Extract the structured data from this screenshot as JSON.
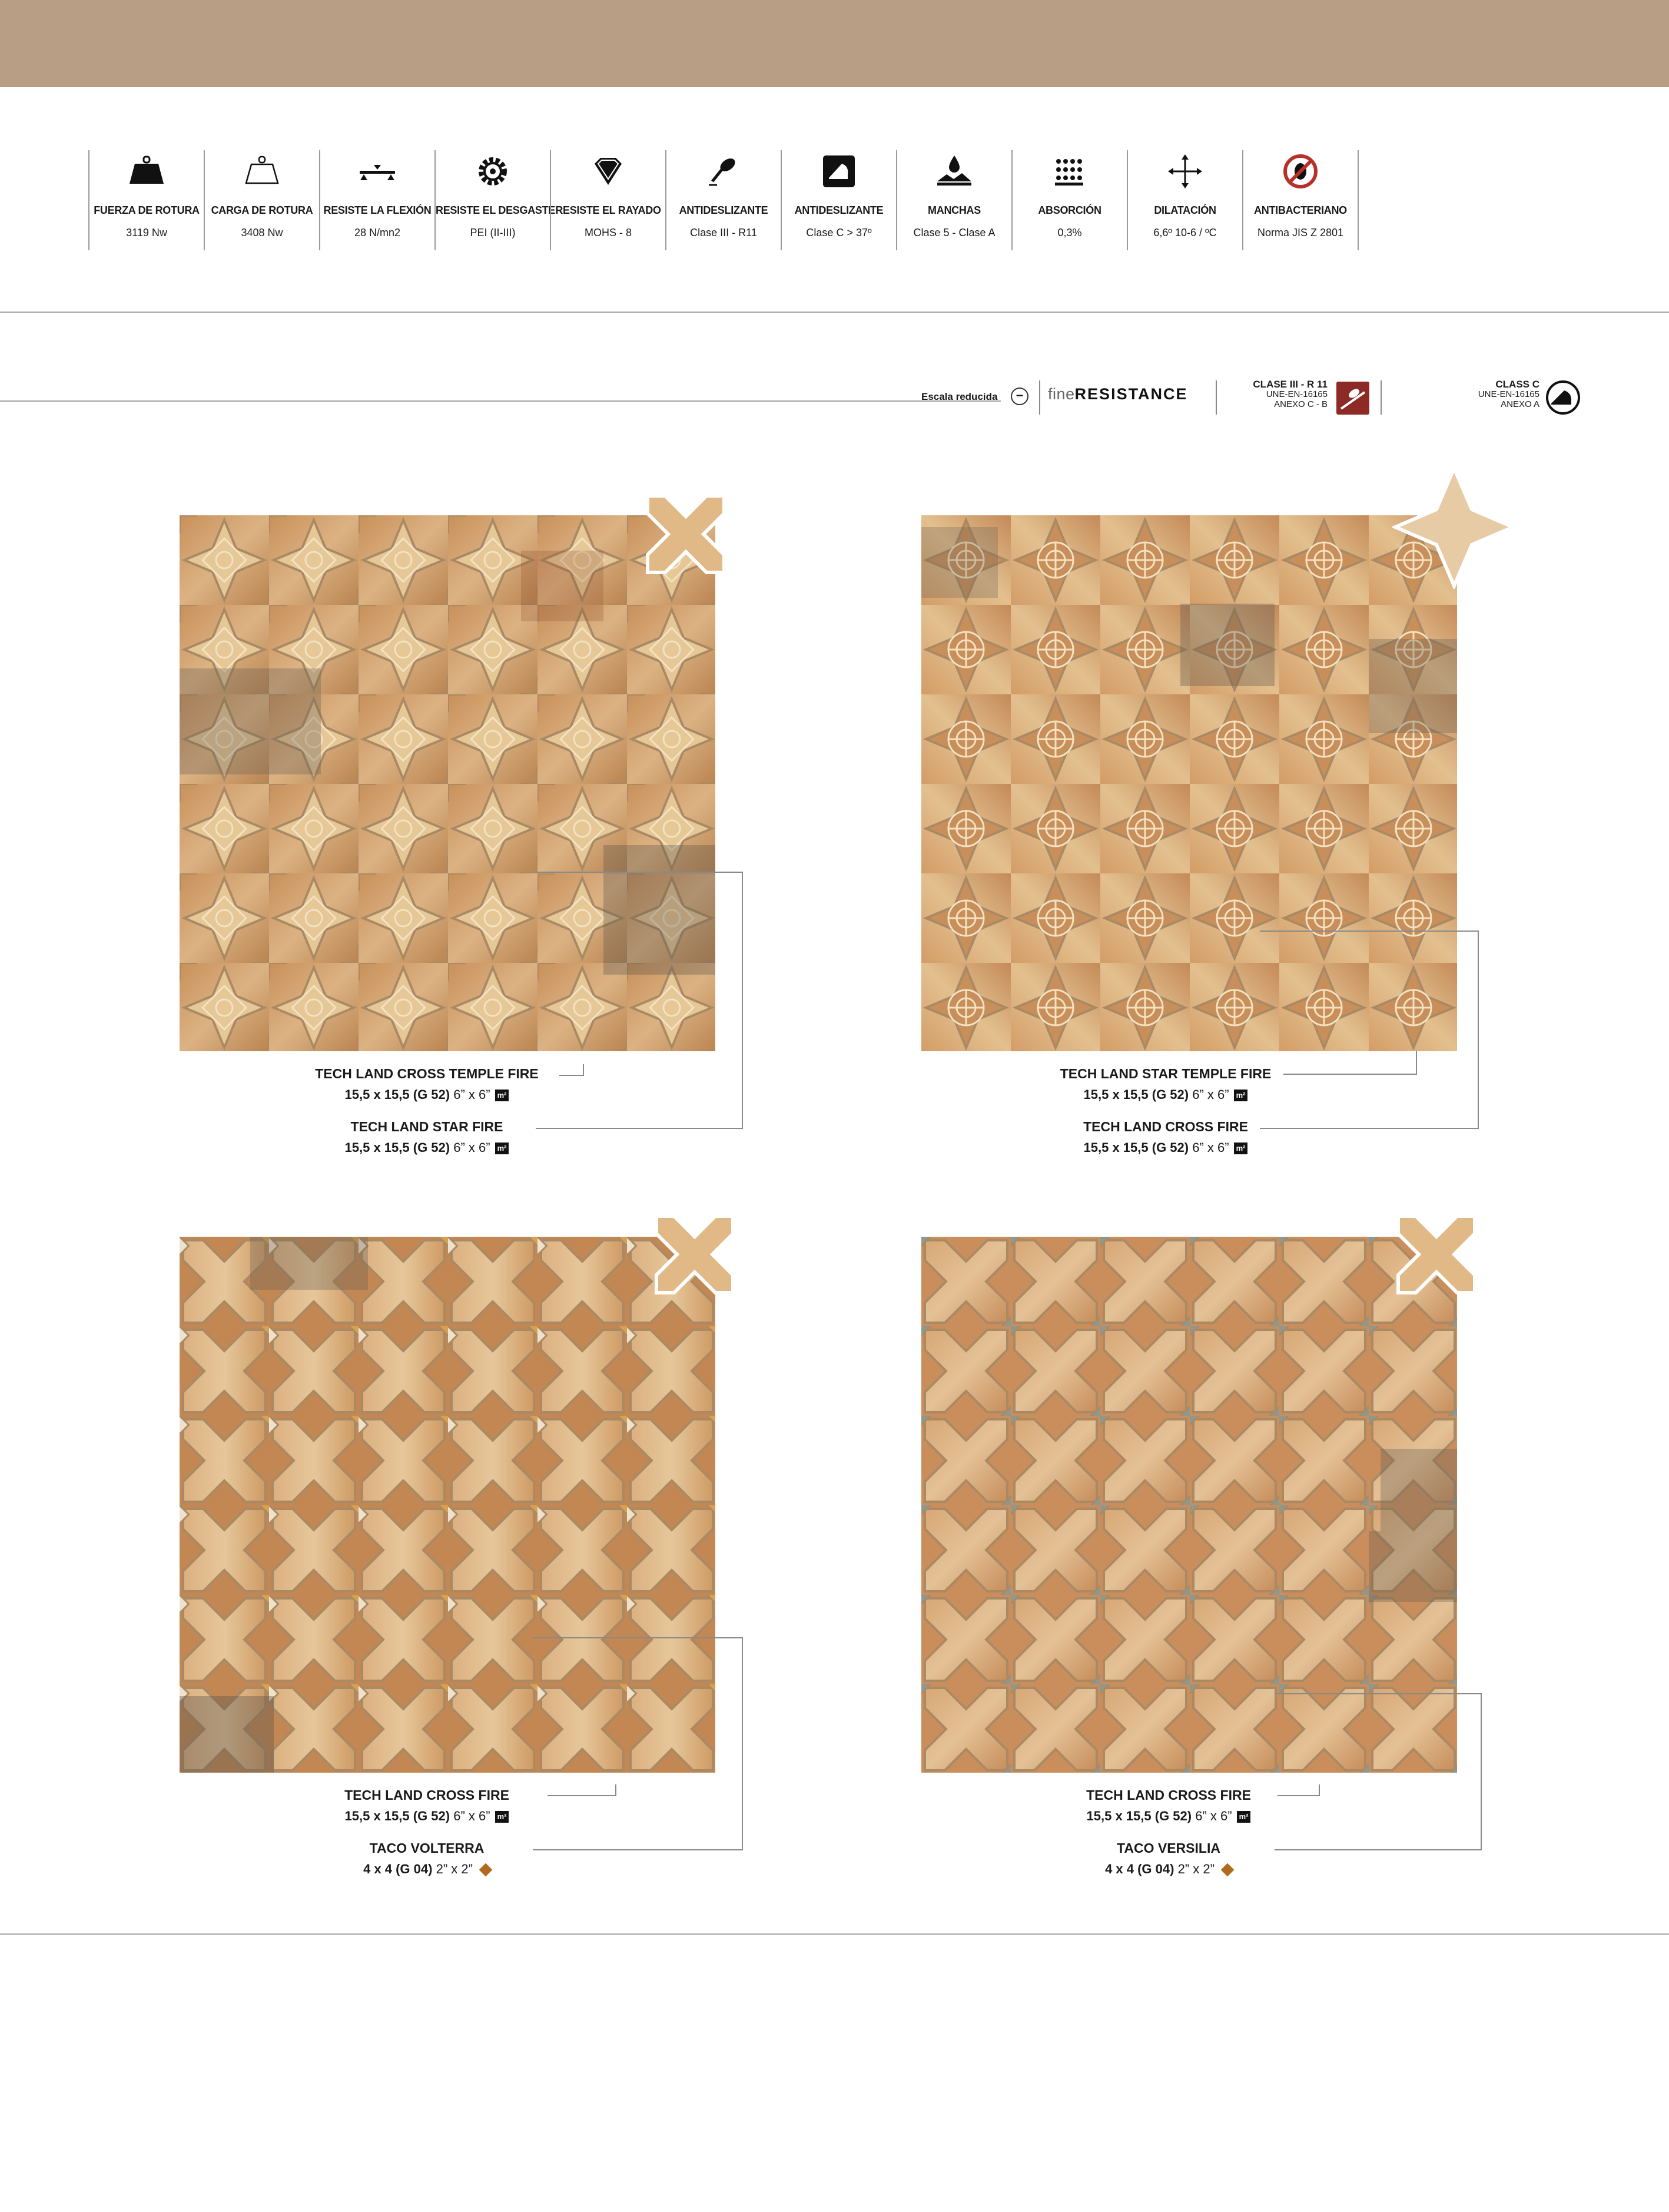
{
  "colors": {
    "topbar": "#b89e84",
    "terracotta": "#c98a52",
    "sand": "#e4c291",
    "smoke": "#7d7065",
    "joint": "#b9a98f"
  },
  "specs": [
    {
      "icon": "weight-icon",
      "title": "FUERZA DE ROTURA",
      "value": "3119 Nw"
    },
    {
      "icon": "load-weight-outline-icon",
      "title": "CARGA DE ROTURA",
      "value": "3408 Nw"
    },
    {
      "icon": "flexion-icon",
      "title": "RESISTE LA FLEXIÓN",
      "value": "28 N/mn2"
    },
    {
      "icon": "gear-wear-icon",
      "title": "RESISTE EL DESGASTE",
      "value": "PEI (II-III)"
    },
    {
      "icon": "diamond-icon",
      "title": "RESISTE EL RAYADO",
      "value": "MOHS - 8"
    },
    {
      "icon": "anti-slip-shoe-icon",
      "title": "ANTIDESLIZANTE",
      "value": "Clase III - R11"
    },
    {
      "icon": "slip-angle-icon",
      "title": "ANTIDESLIZANTE",
      "value": "Clase C > 37º"
    },
    {
      "icon": "stain-drop-icon",
      "title": "MANCHAS",
      "value": "Clase 5 - Clase A"
    },
    {
      "icon": "absorption-drops-icon",
      "title": "ABSORCIÓN",
      "value": "0,3%"
    },
    {
      "icon": "dilation-arrows-icon",
      "title": "DILATACIÓN",
      "value": "6,6º 10-6 / ºC"
    },
    {
      "icon": "antibacterial-icon",
      "title": "ANTIBACTERIANO",
      "value": "Norma JIS Z 2801"
    }
  ],
  "legend": {
    "escala": "Escala reducida",
    "fine_a": "fine",
    "fine_b": "RESISTANCE",
    "r11_title": "CLASE III - R 11",
    "r11_line1": "UNE-EN-16165",
    "r11_line2": "ANEXO C - B",
    "c_title": "CLASS C",
    "c_line1": "UNE-EN-16165",
    "c_line2": "ANEXO A"
  },
  "products": [
    {
      "lines": [
        {
          "name": "TECH LAND CROSS TEMPLE FIRE",
          "size": "15,5 x 15,5 (G 52)",
          "inch": "6” x 6”",
          "unit": "m²"
        },
        {
          "name": "TECH LAND STAR FIRE",
          "size": "15,5 x 15,5 (G 52)",
          "inch": "6” x 6”",
          "unit": "m²"
        }
      ]
    },
    {
      "lines": [
        {
          "name": "TECH LAND STAR TEMPLE FIRE",
          "size": "15,5 x 15,5 (G 52)",
          "inch": "6” x 6”",
          "unit": "m²"
        },
        {
          "name": "TECH LAND CROSS FIRE",
          "size": "15,5 x 15,5 (G 52)",
          "inch": "6” x 6”",
          "unit": "m²"
        }
      ]
    },
    {
      "lines": [
        {
          "name": "TECH LAND CROSS FIRE",
          "size": "15,5 x 15,5 (G 52)",
          "inch": "6” x 6”",
          "unit": "m²"
        },
        {
          "name": "TACO VOLTERRA",
          "size": "4 x 4 (G 04)",
          "inch": "2” x 2”",
          "unit": ""
        }
      ]
    },
    {
      "lines": [
        {
          "name": "TECH LAND CROSS FIRE",
          "size": "15,5 x 15,5 (G 52)",
          "inch": "6” x 6”",
          "unit": "m²"
        },
        {
          "name": "TACO VERSILIA",
          "size": "4 x 4 (G 04)",
          "inch": "2” x 2”",
          "unit": ""
        }
      ]
    }
  ]
}
